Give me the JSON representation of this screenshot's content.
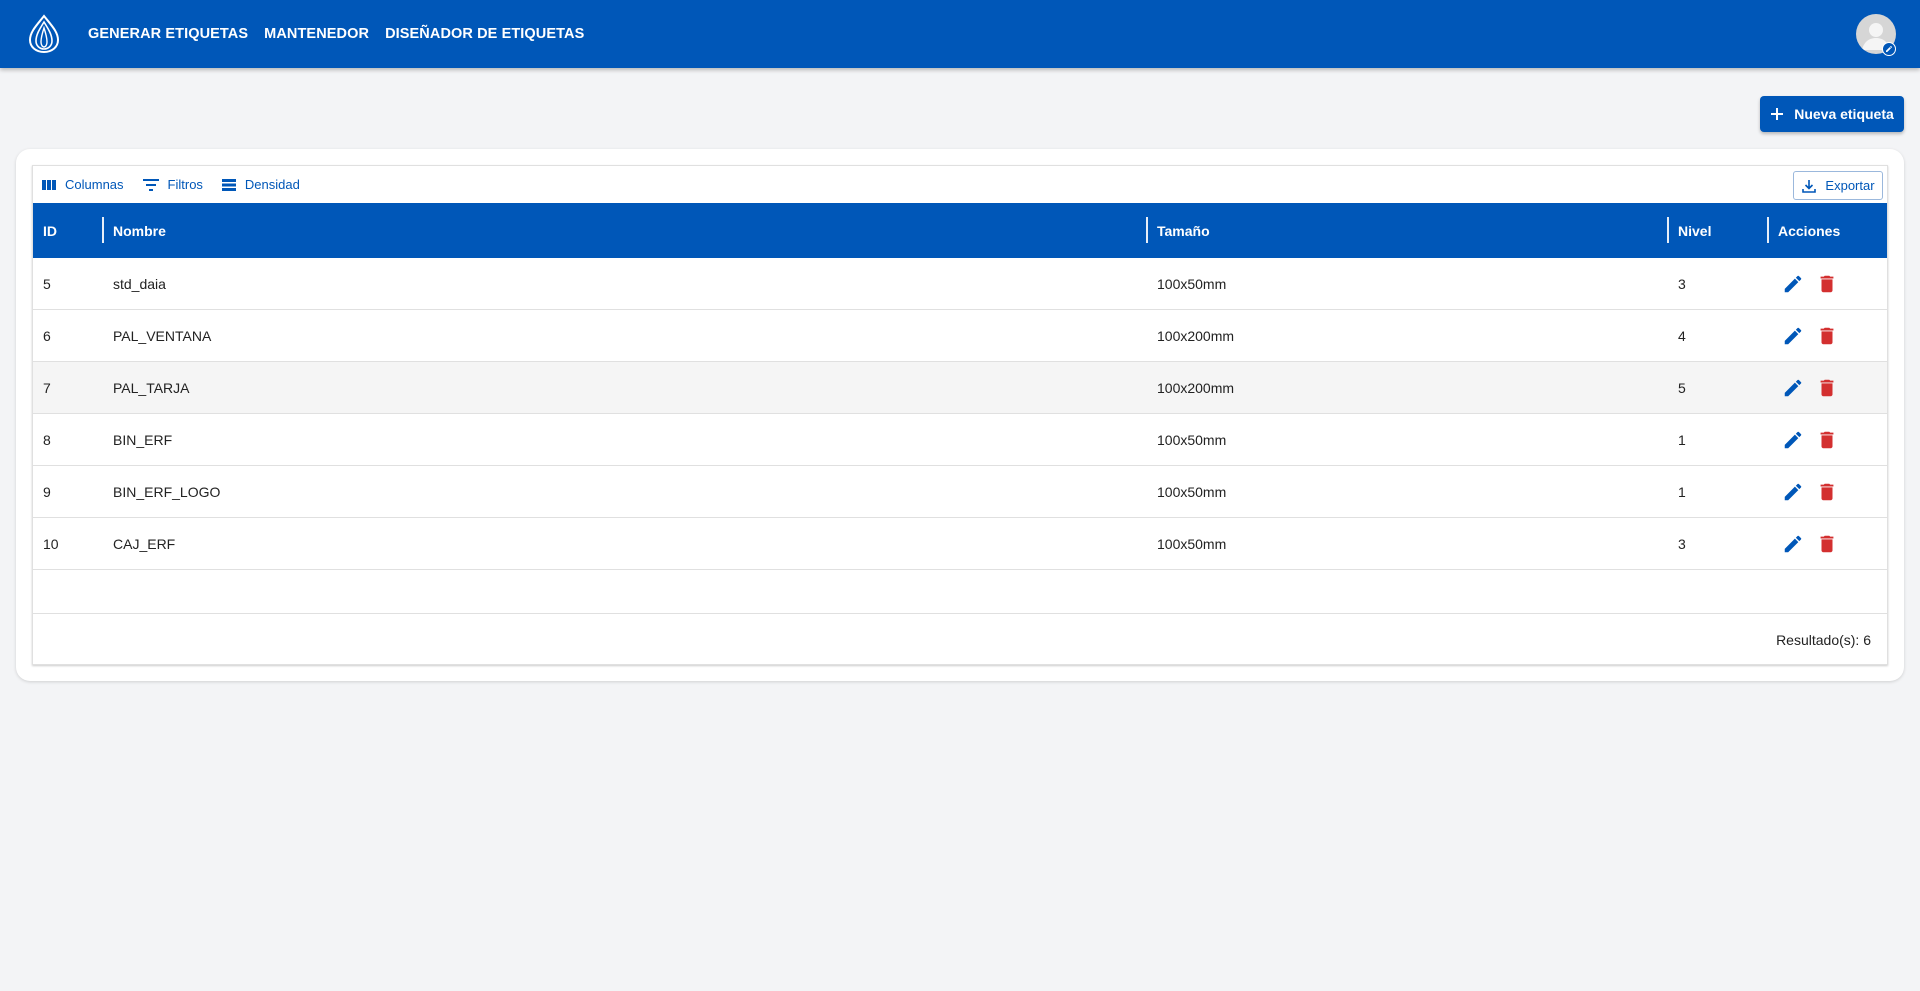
{
  "colors": {
    "primary": "#0057b8",
    "danger": "#d32f2f",
    "background": "#f3f4f6"
  },
  "header": {
    "logo_icon": "flame-logo-icon",
    "nav": [
      {
        "label": "GENERAR ETIQUETAS"
      },
      {
        "label": "MANTENEDOR"
      },
      {
        "label": "DISEÑADOR DE ETIQUETAS"
      }
    ],
    "avatar_icon": "user-avatar-icon"
  },
  "actions": {
    "new_label": "Nueva etiqueta",
    "new_icon": "plus-icon"
  },
  "toolbar": {
    "columns_label": "Columnas",
    "filters_label": "Filtros",
    "density_label": "Densidad",
    "export_label": "Exportar"
  },
  "table": {
    "headers": {
      "id": "ID",
      "name": "Nombre",
      "size": "Tamaño",
      "level": "Nivel",
      "actions": "Acciones"
    },
    "rows": [
      {
        "id": "5",
        "name": "std_daia",
        "size": "100x50mm",
        "level": "3"
      },
      {
        "id": "6",
        "name": "PAL_VENTANA",
        "size": "100x200mm",
        "level": "4"
      },
      {
        "id": "7",
        "name": "PAL_TARJA",
        "size": "100x200mm",
        "level": "5"
      },
      {
        "id": "8",
        "name": "BIN_ERF",
        "size": "100x50mm",
        "level": "1"
      },
      {
        "id": "9",
        "name": "BIN_ERF_LOGO",
        "size": "100x50mm",
        "level": "1"
      },
      {
        "id": "10",
        "name": "CAJ_ERF",
        "size": "100x50mm",
        "level": "3"
      }
    ],
    "row_icons": {
      "edit": "pencil-icon",
      "delete": "trash-icon"
    }
  },
  "footer": {
    "results": "Resultado(s): 6"
  }
}
